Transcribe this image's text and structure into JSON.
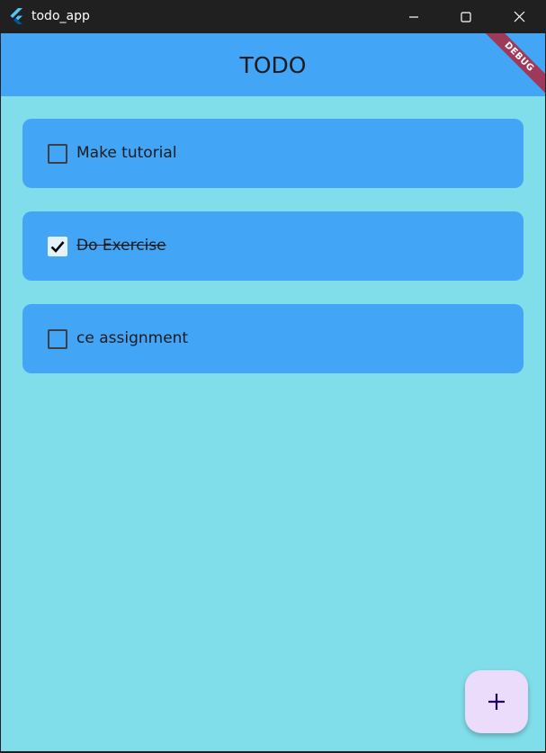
{
  "window": {
    "title": "todo_app",
    "icon": "flutter-logo-icon",
    "controls": {
      "minimize_icon": "minimize-icon",
      "maximize_icon": "maximize-icon",
      "close_icon": "close-icon"
    }
  },
  "appbar": {
    "title": "TODO",
    "banner": "DEBUG"
  },
  "todos": [
    {
      "label": "Make tutorial",
      "checked": false
    },
    {
      "label": "Do Exercise",
      "checked": true
    },
    {
      "label": "ce assignment",
      "checked": false
    }
  ],
  "fab": {
    "icon": "plus-icon"
  },
  "colors": {
    "background": "#80deea",
    "appbar": "#42a5f5",
    "card": "#42a5f5",
    "fab": "#ecdcfb",
    "fab_icon": "#21005d",
    "debug_banner": "#a0385a",
    "titlebar": "#202020"
  }
}
